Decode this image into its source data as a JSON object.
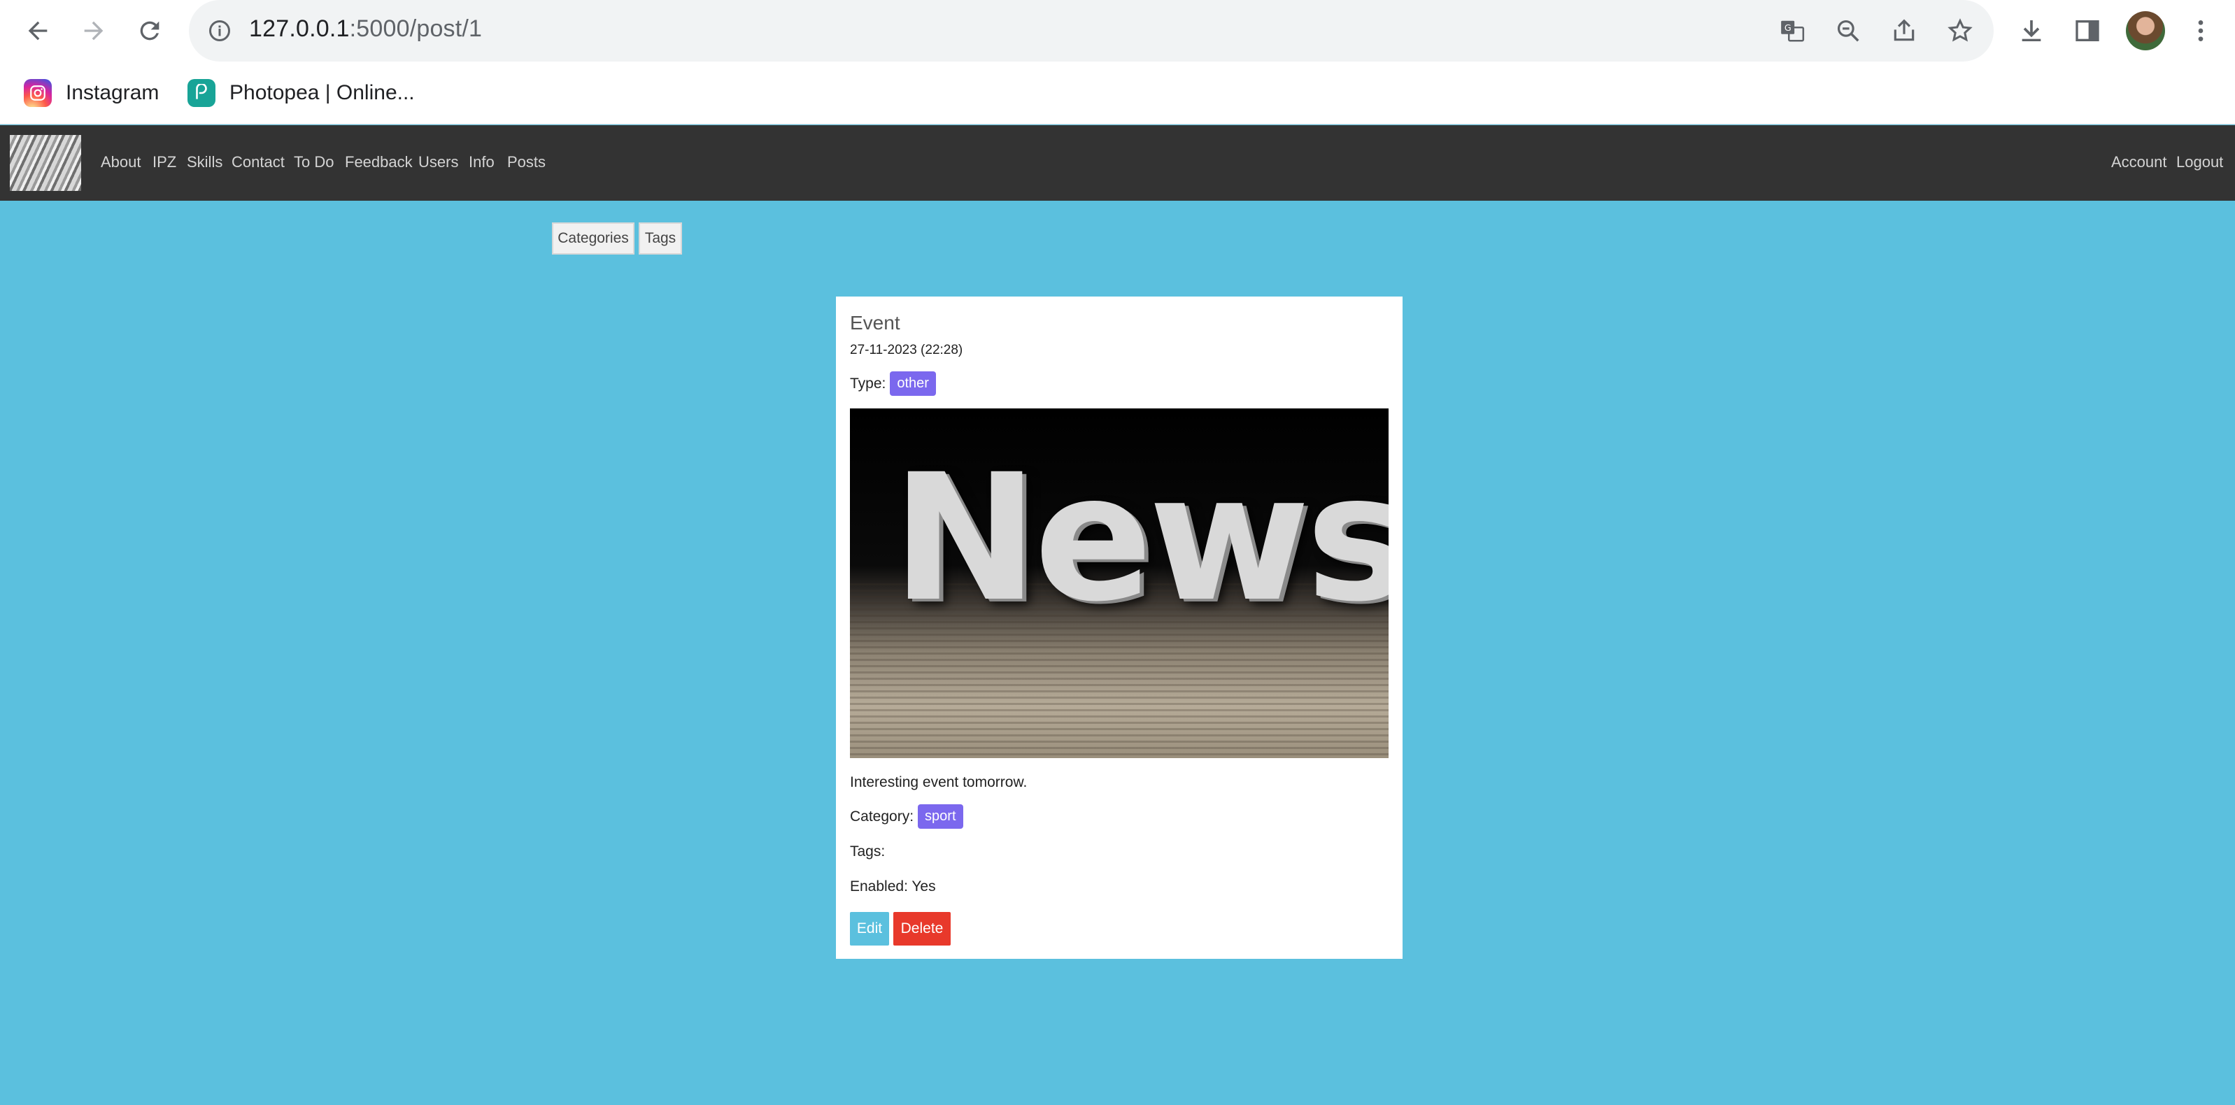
{
  "browser": {
    "url_host": "127.0.0.1",
    "url_path": ":5000/post/1",
    "bookmarks": [
      {
        "label": "Instagram",
        "icon": "instagram-icon"
      },
      {
        "label": "Photopea | Online...",
        "icon": "photopea-icon"
      }
    ]
  },
  "navbar": {
    "links": [
      "About",
      "IPZ",
      "Skills",
      "Contact",
      "To Do",
      "Feedback",
      "Users",
      "Info",
      "Posts"
    ],
    "right_links": [
      "Account",
      "Logout"
    ]
  },
  "toolbar": {
    "categories_label": "Categories",
    "tags_label": "Tags"
  },
  "post": {
    "title": "Event",
    "date": "27-11-2023 (22:28)",
    "type_label": "Type:",
    "type_value": "other",
    "image_alt": "News",
    "description": "Interesting event tomorrow.",
    "category_label": "Category:",
    "category_value": "sport",
    "tags_label": "Tags:",
    "enabled_label": "Enabled: Yes",
    "edit_label": "Edit",
    "delete_label": "Delete"
  },
  "colors": {
    "page_bg": "#5bc0de",
    "navbar_bg": "#333333",
    "badge": "#7b68ee",
    "edit": "#5bc0de",
    "delete": "#e8392b"
  }
}
